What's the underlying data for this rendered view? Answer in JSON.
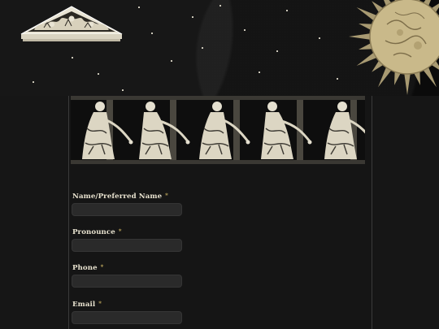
{
  "hero": {
    "pediment_icon": "pediment-relief",
    "sun_icon": "engraved-sun"
  },
  "frieze": {
    "icon": "dancing-figures-frieze"
  },
  "form": {
    "fields": [
      {
        "label": "Name/Preferred Name",
        "required_mark": "*",
        "value": "",
        "placeholder": ""
      },
      {
        "label": "Pronounce",
        "required_mark": "*",
        "value": "",
        "placeholder": ""
      },
      {
        "label": "Phone",
        "required_mark": "*",
        "value": "",
        "placeholder": ""
      },
      {
        "label": "Email",
        "required_mark": "*",
        "value": "",
        "placeholder": ""
      }
    ]
  },
  "colors": {
    "page_bg": "#161616",
    "hero_bg": "#0b0b0b",
    "label_text": "#e8e2cf",
    "required_mark": "#b9a35a",
    "input_bg": "#2a2a2a",
    "sun_gold": "#c9b98a"
  }
}
